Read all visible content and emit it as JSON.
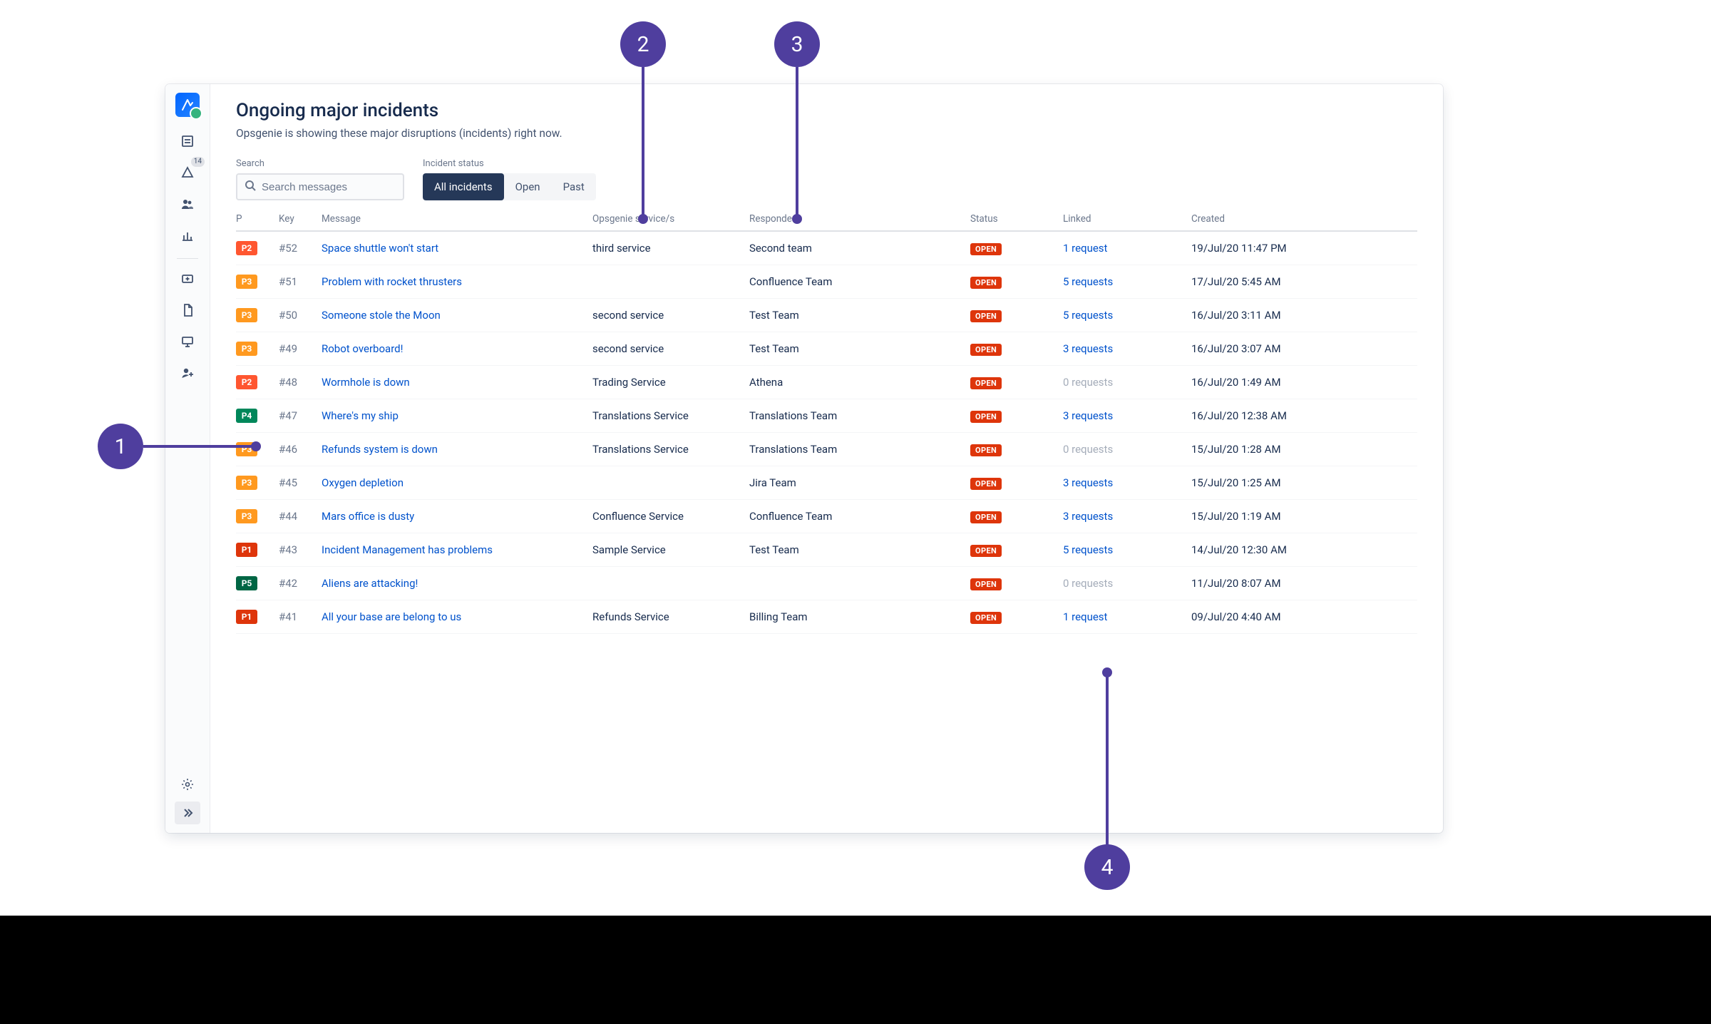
{
  "page": {
    "title": "Ongoing major incidents",
    "description": "Opsgenie is showing these major disruptions (incidents) right now."
  },
  "sidebar": {
    "badge_count": "14"
  },
  "controls": {
    "search_label": "Search",
    "search_placeholder": "Search messages",
    "status_label": "Incident status",
    "segments": {
      "all": "All incidents",
      "open": "Open",
      "past": "Past"
    }
  },
  "columns": {
    "p": "P",
    "key": "Key",
    "message": "Message",
    "service": "Opsgenie service/s",
    "responders": "Responders",
    "status": "Status",
    "linked": "Linked",
    "created": "Created"
  },
  "status_labels": {
    "open": "OPEN"
  },
  "rows": [
    {
      "priority": "P2",
      "key": "#52",
      "message": "Space shuttle won't start",
      "service": "third service",
      "responders": "Second team",
      "status": "open",
      "linked": "1 request",
      "linked_n": 1,
      "created": "19/Jul/20 11:47 PM"
    },
    {
      "priority": "P3",
      "key": "#51",
      "message": "Problem with rocket thrusters",
      "service": "",
      "responders": "Confluence Team",
      "status": "open",
      "linked": "5 requests",
      "linked_n": 5,
      "created": "17/Jul/20 5:45 AM"
    },
    {
      "priority": "P3",
      "key": "#50",
      "message": "Someone stole the Moon",
      "service": "second service",
      "responders": "Test Team",
      "status": "open",
      "linked": "5 requests",
      "linked_n": 5,
      "created": "16/Jul/20 3:11 AM"
    },
    {
      "priority": "P3",
      "key": "#49",
      "message": "Robot overboard!",
      "service": "second service",
      "responders": "Test Team",
      "status": "open",
      "linked": "3 requests",
      "linked_n": 3,
      "created": "16/Jul/20 3:07 AM"
    },
    {
      "priority": "P2",
      "key": "#48",
      "message": "Wormhole is down",
      "service": "Trading Service",
      "responders": "Athena",
      "status": "open",
      "linked": "0 requests",
      "linked_n": 0,
      "created": "16/Jul/20 1:49 AM"
    },
    {
      "priority": "P4",
      "key": "#47",
      "message": "Where's my ship",
      "service": "Translations Service",
      "responders": "Translations Team",
      "status": "open",
      "linked": "3 requests",
      "linked_n": 3,
      "created": "16/Jul/20 12:38 AM"
    },
    {
      "priority": "P3",
      "key": "#46",
      "message": "Refunds system is down",
      "service": "Translations Service",
      "responders": "Translations Team",
      "status": "open",
      "linked": "0 requests",
      "linked_n": 0,
      "created": "15/Jul/20 1:28 AM"
    },
    {
      "priority": "P3",
      "key": "#45",
      "message": "Oxygen depletion",
      "service": "",
      "responders": "Jira Team",
      "status": "open",
      "linked": "3 requests",
      "linked_n": 3,
      "created": "15/Jul/20 1:25 AM"
    },
    {
      "priority": "P3",
      "key": "#44",
      "message": "Mars office is dusty",
      "service": "Confluence Service",
      "responders": "Confluence Team",
      "status": "open",
      "linked": "3 requests",
      "linked_n": 3,
      "created": "15/Jul/20 1:19 AM"
    },
    {
      "priority": "P1",
      "key": "#43",
      "message": "Incident Management has problems",
      "service": "Sample Service",
      "responders": "Test Team",
      "status": "open",
      "linked": "5 requests",
      "linked_n": 5,
      "created": "14/Jul/20 12:30 AM"
    },
    {
      "priority": "P5",
      "key": "#42",
      "message": "Aliens are attacking!",
      "service": "",
      "responders": "",
      "status": "open",
      "linked": "0 requests",
      "linked_n": 0,
      "created": "11/Jul/20 8:07 AM"
    },
    {
      "priority": "P1",
      "key": "#41",
      "message": "All your base are belong to us",
      "service": "Refunds Service",
      "responders": "Billing Team",
      "status": "open",
      "linked": "1 request",
      "linked_n": 1,
      "created": "09/Jul/20 4:40 AM"
    }
  ],
  "annotations": {
    "a1": "1",
    "a2": "2",
    "a3": "3",
    "a4": "4"
  }
}
